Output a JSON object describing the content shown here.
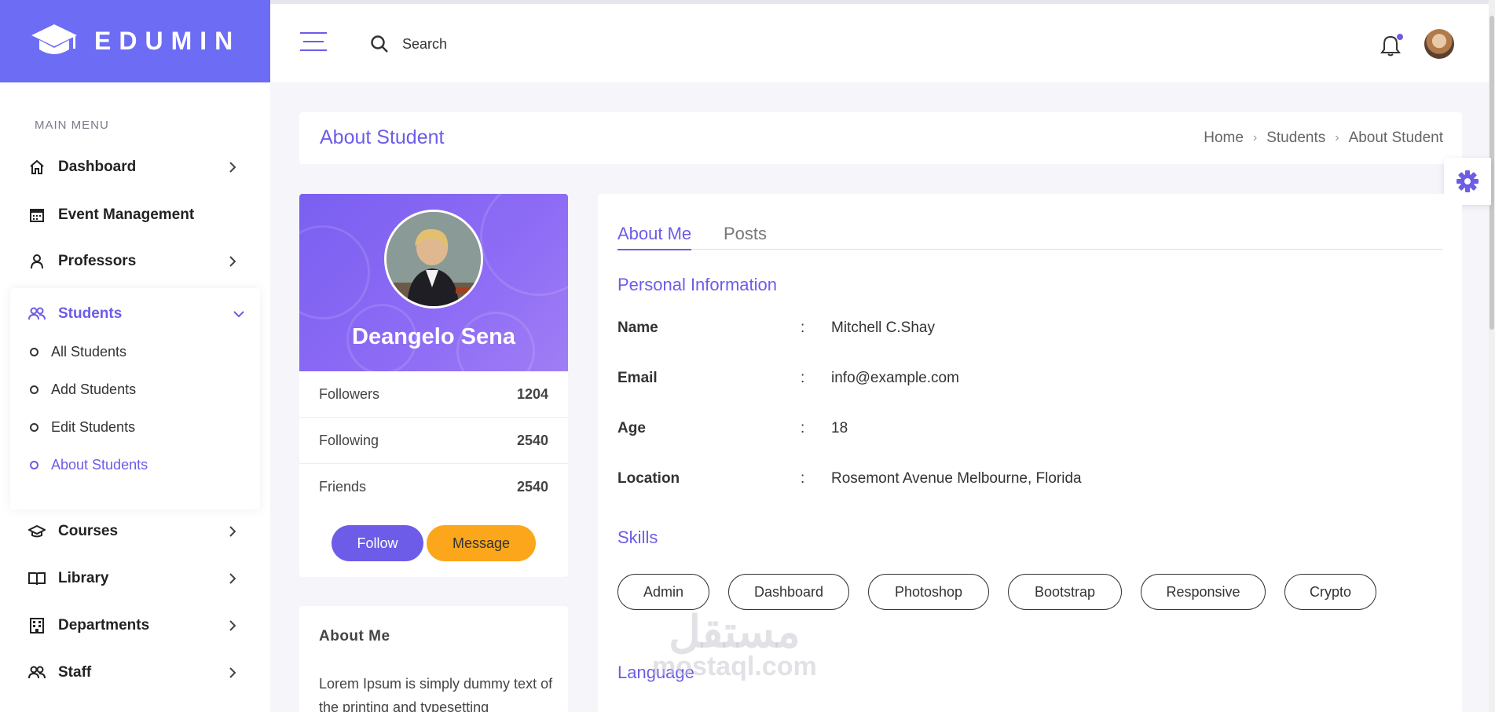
{
  "brand": {
    "name": "EDUMIN",
    "color": "#6c6cf5"
  },
  "sidebar": {
    "menu_title": "MAIN MENU",
    "items": [
      {
        "label": "Dashboard",
        "icon": "home-icon"
      },
      {
        "label": "Event Management",
        "icon": "calendar-icon"
      },
      {
        "label": "Professors",
        "icon": "user-icon"
      },
      {
        "label": "Students",
        "icon": "users-icon",
        "expanded": true
      },
      {
        "label": "Courses",
        "icon": "graduation-cap-icon"
      },
      {
        "label": "Library",
        "icon": "book-icon"
      },
      {
        "label": "Departments",
        "icon": "building-icon"
      },
      {
        "label": "Staff",
        "icon": "users-icon"
      }
    ],
    "students_sub": [
      "All Students",
      "Add Students",
      "Edit Students",
      "About Students"
    ]
  },
  "header": {
    "search_placeholder": "Search"
  },
  "page": {
    "title": "About Student",
    "breadcrumb": [
      "Home",
      "Students",
      "About Student"
    ]
  },
  "profile": {
    "name": "Deangelo Sena",
    "stats": [
      {
        "label": "Followers",
        "value": "1204"
      },
      {
        "label": "Following",
        "value": "2540"
      },
      {
        "label": "Friends",
        "value": "2540"
      }
    ],
    "follow_label": "Follow",
    "message_label": "Message"
  },
  "about_card": {
    "title": "About Me",
    "text": "Lorem Ipsum is simply dummy text of the printing and typesetting"
  },
  "info": {
    "tabs": [
      "About Me",
      "Posts"
    ],
    "personal_title": "Personal Information",
    "rows": [
      {
        "label": "Name",
        "colon": ":",
        "value": "Mitchell C.Shay"
      },
      {
        "label": "Email",
        "colon": ":",
        "value": "info@example.com"
      },
      {
        "label": "Age",
        "colon": ":",
        "value": "18"
      },
      {
        "label": "Location",
        "colon": ":",
        "value": "Rosemont Avenue Melbourne, Florida"
      }
    ],
    "skills_title": "Skills",
    "skills": [
      "Admin",
      "Dashboard",
      "Photoshop",
      "Bootstrap",
      "Responsive",
      "Crypto"
    ],
    "language_title": "Language"
  },
  "watermark": {
    "arabic": "مستقل",
    "latin": "mostaql.com"
  },
  "colors": {
    "accent": "#6c5ce7",
    "warning": "#fba61b"
  }
}
